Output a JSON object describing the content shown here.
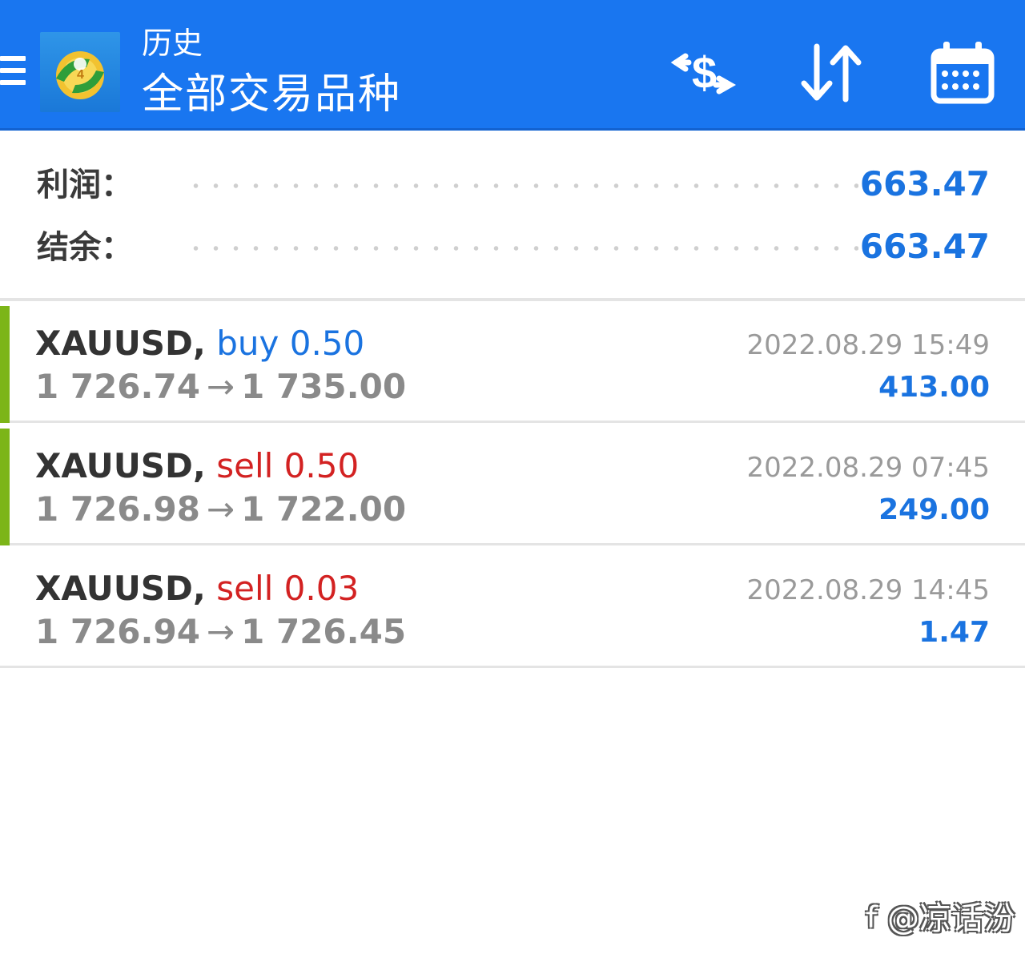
{
  "header": {
    "title": "历史",
    "subtitle": "全部交易品种"
  },
  "icons": {
    "menu": "hamburger-menu-icon",
    "logo": "metatrader-4-logo",
    "deposits": "dollar-exchange-icon",
    "sort": "sort-arrows-icon",
    "period": "calendar-icon"
  },
  "summary": {
    "profit_label": "利润：",
    "profit_value": "663.47",
    "balance_label": "结余：",
    "balance_value": "663.47"
  },
  "trades": [
    {
      "symbol": "XAUUSD,",
      "side": "buy",
      "volume": "0.50",
      "open_price": "1 726.74",
      "arrow": "→",
      "close_price": "1 735.00",
      "time": "2022.08.29 15:49",
      "profit": "413.00",
      "has_marker": true
    },
    {
      "symbol": "XAUUSD,",
      "side": "sell",
      "volume": "0.50",
      "open_price": "1 726.98",
      "arrow": "→",
      "close_price": "1 722.00",
      "time": "2022.08.29 07:45",
      "profit": "249.00",
      "has_marker": true
    },
    {
      "symbol": "XAUUSD,",
      "side": "sell",
      "volume": "0.03",
      "open_price": "1 726.94",
      "arrow": "→",
      "close_price": "1 726.45",
      "time": "2022.08.29 14:45",
      "profit": "1.47",
      "has_marker": false
    }
  ],
  "watermark": "@凉话汾",
  "colors": {
    "appbar": "#1976f0",
    "accent_blue": "#1a73e0",
    "sell_red": "#d32222",
    "marker_green": "#7cb518",
    "muted_text": "#8a8a8a"
  }
}
